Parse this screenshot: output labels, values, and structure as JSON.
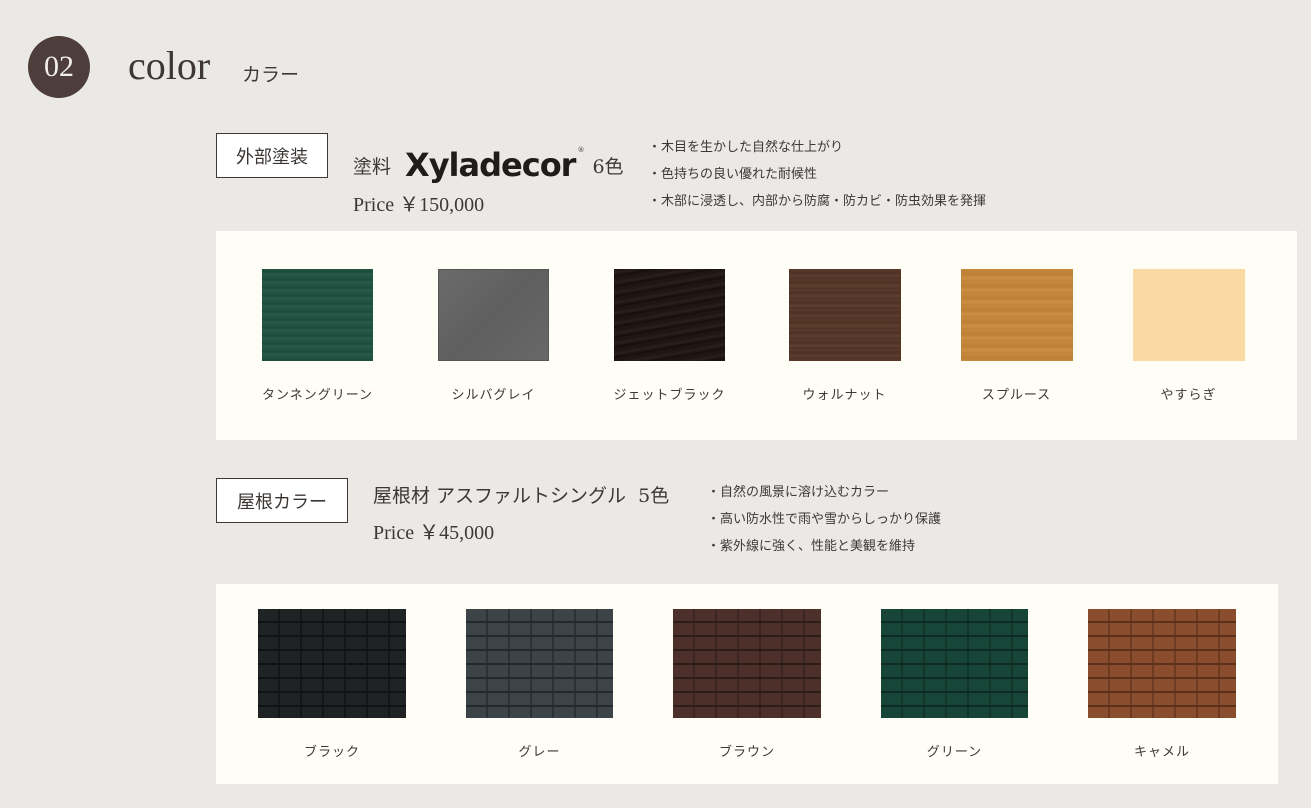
{
  "header": {
    "number": "02",
    "title": "color",
    "subtitle": "カラー"
  },
  "exterior": {
    "tag": "外部塗装",
    "material": "塗料",
    "brand": "Xyladecor",
    "brand_mark": "®",
    "count": "6色",
    "price": "Price ￥150,000",
    "features": [
      "・木目を生かした自然な仕上がり",
      "・色持ちの良い優れた耐候性",
      "・木部に浸透し、内部から防腐・防カビ・防虫効果を発揮"
    ],
    "colors": [
      {
        "label": "タンネングリーン",
        "color": "#235543"
      },
      {
        "label": "シルバグレイ",
        "color": "#666666"
      },
      {
        "label": "ジェットブラック",
        "color": "#1c1412"
      },
      {
        "label": "ウォルナット",
        "color": "#56382a"
      },
      {
        "label": "スプルース",
        "color": "#c6873c"
      },
      {
        "label": "やすらぎ",
        "color": "#fbd9a3"
      }
    ]
  },
  "roof": {
    "tag": "屋根カラー",
    "product": "屋根材 アスファルトシングル",
    "count": "5色",
    "price": "Price ￥45,000",
    "features": [
      "・自然の風景に溶け込むカラー",
      "・高い防水性で雨や雪からしっかり保護",
      "・紫外線に強く、性能と美観を維持"
    ],
    "colors": [
      {
        "label": "ブラック",
        "color": "#1f2323"
      },
      {
        "label": "グレー",
        "color": "#3d4448"
      },
      {
        "label": "ブラウン",
        "color": "#4c3029"
      },
      {
        "label": "グリーン",
        "color": "#174537"
      },
      {
        "label": "キャメル",
        "color": "#8a4e2f"
      }
    ]
  }
}
